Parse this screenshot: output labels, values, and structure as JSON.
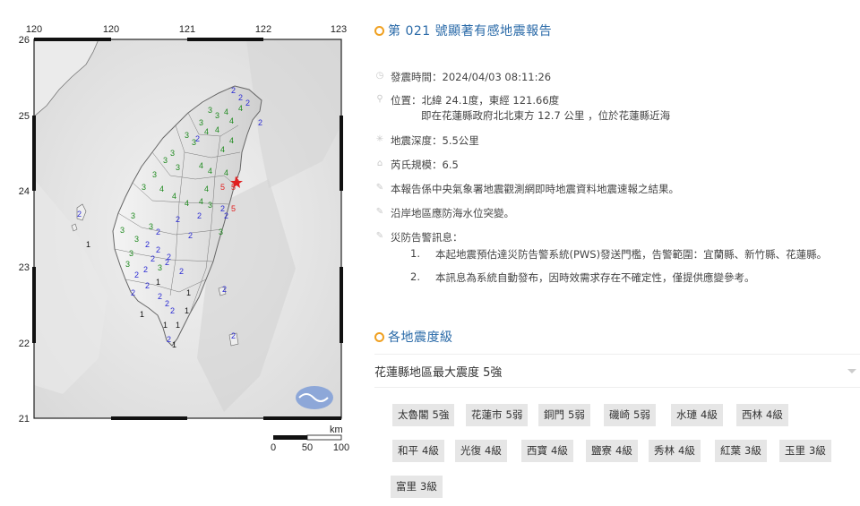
{
  "map": {
    "lon_ticks": [
      "120",
      "121",
      "122",
      "123"
    ],
    "lat_ticks": [
      "26",
      "25",
      "24",
      "23",
      "22",
      "21"
    ],
    "scale": {
      "unit": "km",
      "labels": [
        "0",
        "50",
        "100"
      ]
    },
    "intensity_labels": [
      {
        "v": "2",
        "c": "blue"
      },
      {
        "v": "2",
        "c": "blue"
      },
      {
        "v": "2",
        "c": "blue"
      },
      {
        "v": "4",
        "c": "green"
      },
      {
        "v": "5",
        "c": "red"
      },
      {
        "v": "3",
        "c": "green"
      },
      {
        "v": "3",
        "c": "green"
      },
      {
        "v": "4",
        "c": "green"
      },
      {
        "v": "4",
        "c": "green"
      },
      {
        "v": "2",
        "c": "blue"
      },
      {
        "v": "3",
        "c": "green"
      },
      {
        "v": "4",
        "c": "green"
      },
      {
        "v": "3",
        "c": "green"
      },
      {
        "v": "4",
        "c": "green"
      },
      {
        "v": "3",
        "c": "green"
      },
      {
        "v": "2",
        "c": "blue"
      },
      {
        "v": "4",
        "c": "green"
      },
      {
        "v": "4",
        "c": "green"
      },
      {
        "v": "3",
        "c": "green"
      },
      {
        "v": "3",
        "c": "green"
      },
      {
        "v": "4",
        "c": "green"
      },
      {
        "v": "4",
        "c": "green"
      },
      {
        "v": "4",
        "c": "green"
      },
      {
        "v": "3",
        "c": "green"
      },
      {
        "v": "5",
        "c": "red"
      },
      {
        "v": "5",
        "c": "red"
      },
      {
        "v": "5",
        "c": "red"
      },
      {
        "v": "3",
        "c": "green"
      },
      {
        "v": "3",
        "c": "green"
      },
      {
        "v": "4",
        "c": "green"
      },
      {
        "v": "4",
        "c": "green"
      },
      {
        "v": "4",
        "c": "green"
      },
      {
        "v": "3",
        "c": "green"
      },
      {
        "v": "3",
        "c": "green"
      },
      {
        "v": "3",
        "c": "green"
      },
      {
        "v": "3",
        "c": "green"
      },
      {
        "v": "2",
        "c": "blue"
      },
      {
        "v": "3",
        "c": "green"
      },
      {
        "v": "2",
        "c": "blue"
      },
      {
        "v": "2",
        "c": "blue"
      },
      {
        "v": "3",
        "c": "green"
      },
      {
        "v": "2",
        "c": "blue"
      },
      {
        "v": "2",
        "c": "blue"
      },
      {
        "v": "3",
        "c": "green"
      },
      {
        "v": "2",
        "c": "blue"
      },
      {
        "v": "2",
        "c": "blue"
      },
      {
        "v": "2",
        "c": "blue"
      },
      {
        "v": "2",
        "c": "blue"
      },
      {
        "v": "1",
        "c": "black"
      },
      {
        "v": "2",
        "c": "blue"
      },
      {
        "v": "2",
        "c": "blue"
      },
      {
        "v": "1",
        "c": "black"
      },
      {
        "v": "2",
        "c": "blue"
      },
      {
        "v": "2",
        "c": "blue"
      },
      {
        "v": "1",
        "c": "black"
      },
      {
        "v": "1",
        "c": "black"
      },
      {
        "v": "2",
        "c": "blue"
      },
      {
        "v": "1",
        "c": "black"
      },
      {
        "v": "2",
        "c": "blue"
      },
      {
        "v": "1",
        "c": "black"
      },
      {
        "v": "1",
        "c": "black"
      },
      {
        "v": "2",
        "c": "blue"
      },
      {
        "v": "2",
        "c": "blue"
      },
      {
        "v": "1",
        "c": "black"
      },
      {
        "v": "2",
        "c": "blue"
      },
      {
        "v": "2",
        "c": "blue"
      },
      {
        "v": "3",
        "c": "green"
      },
      {
        "v": "3",
        "c": "green"
      },
      {
        "v": "2",
        "c": "blue"
      },
      {
        "v": "2",
        "c": "blue"
      },
      {
        "v": "4",
        "c": "green"
      },
      {
        "v": "4",
        "c": "green"
      },
      {
        "v": "2",
        "c": "blue"
      },
      {
        "v": "2",
        "c": "blue"
      }
    ]
  },
  "report": {
    "title": "第 021 號顯著有感地震報告",
    "time": "發震時間：2024/04/03 08:11:26",
    "location_line1": "位置：北緯 24.1度，東經 121.66度",
    "location_line2": "即在花蓮縣政府北北東方 12.7 公里 ，位於花蓮縣近海",
    "depth": "地震深度：5.5公里",
    "magnitude": "芮氏規模：6.5",
    "note1": "本報告係中央氣象署地震觀測網即時地震資料地震速報之結果。",
    "note2": "沿岸地區應防海水位突變。",
    "warn_title": "災防告警訊息：",
    "warn_items": [
      {
        "num": "1.",
        "text": "本起地震預估達災防告警系統(PWS)發送門檻，告警範圍：宜蘭縣、新竹縣、花蓮縣。"
      },
      {
        "num": "2.",
        "text": "本訊息為系統自動發布，因時效需求存在不確定性，僅提供應變參考。"
      }
    ],
    "section_title": "各地震度級",
    "region_select": "花蓮縣地區最大震度 5強",
    "stations": [
      {
        "name": "太魯閣",
        "level": "5強"
      },
      {
        "name": "花蓮市",
        "level": "5弱"
      },
      {
        "name": "銅門",
        "level": "5弱"
      },
      {
        "name": "磯崎",
        "level": "5弱"
      },
      {
        "name": "水璉",
        "level": "4級"
      },
      {
        "name": "西林",
        "level": "4級"
      },
      {
        "name": "和平",
        "level": "4級"
      },
      {
        "name": "光復",
        "level": "4級"
      },
      {
        "name": "西寶",
        "level": "4級"
      },
      {
        "name": "鹽寮",
        "level": "4級"
      },
      {
        "name": "秀林",
        "level": "4級"
      },
      {
        "name": "紅葉",
        "level": "3級"
      },
      {
        "name": "玉里",
        "level": "3級"
      },
      {
        "name": "富里",
        "level": "3級"
      }
    ],
    "colors": {
      "title": "#2a6aa8",
      "accent": "#f0a020",
      "chip": "#e6e6e6"
    }
  }
}
